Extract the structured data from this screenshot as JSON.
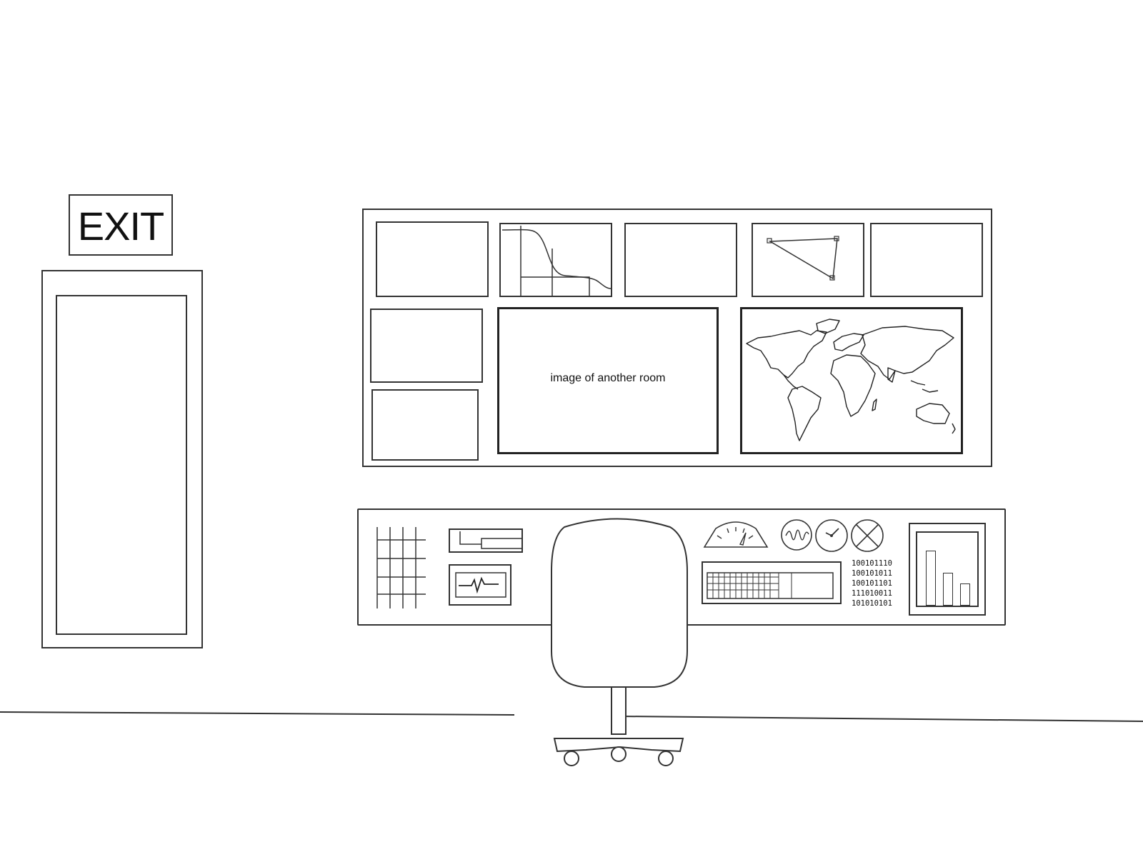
{
  "exit_sign": {
    "label": "EXIT"
  },
  "video_wall": {
    "center_screen_caption": "image of another room"
  },
  "console": {
    "binary_readout": [
      "100101110",
      "100101011",
      "100101101",
      "111010011",
      "101010101"
    ],
    "bar_levels": [
      0.75,
      0.45,
      0.3
    ]
  },
  "colors": {
    "ink": "#333333",
    "background": "#ffffff"
  },
  "icons": {
    "door": "door-icon",
    "chair": "office-chair-icon",
    "gauge": "gauge-icon",
    "oscilloscope": "oscilloscope-icon",
    "clock": "clock-icon",
    "cross_dial": "cross-dial-icon",
    "world_map": "world-map-icon"
  }
}
